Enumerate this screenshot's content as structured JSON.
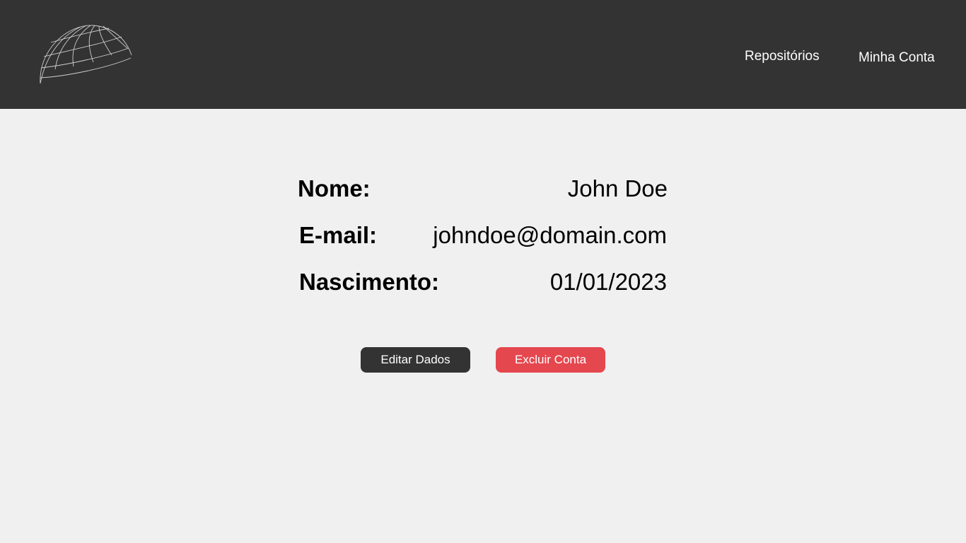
{
  "header": {
    "logo_icon": "globe-wireframe-icon",
    "nav": {
      "repositories": "Repositórios",
      "account": "Minha Conta"
    }
  },
  "profile": {
    "name_label": "Nome:",
    "name_value": "John Doe",
    "email_label": "E-mail:",
    "email_value": "johndoe@domain.com",
    "birth_label": "Nascimento:",
    "birth_value": "01/01/2023"
  },
  "actions": {
    "edit_label": "Editar Dados",
    "delete_label": "Excluir Conta"
  },
  "colors": {
    "header_bg": "#333333",
    "page_bg": "#f0f0f0",
    "delete_button": "#e5474f",
    "edit_button": "#333333"
  }
}
